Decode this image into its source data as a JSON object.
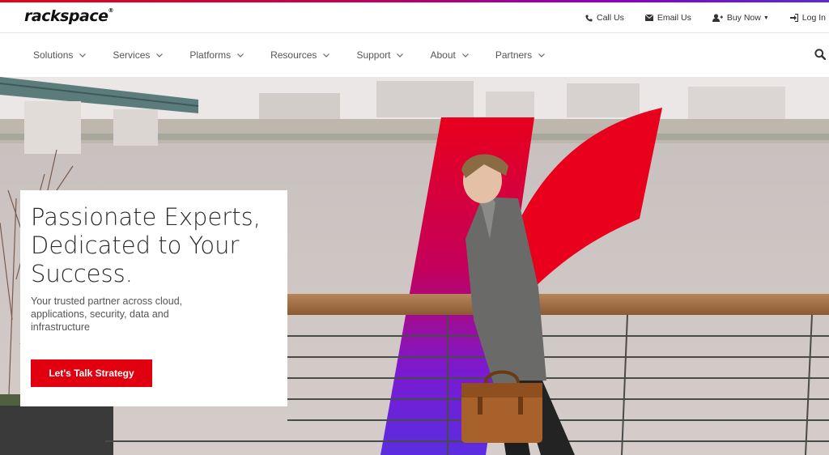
{
  "brand": {
    "logo_text": "rackspace",
    "reg_mark": "®",
    "accent_red": "#e30613",
    "accent_purple": "#5a2bd6"
  },
  "utility_nav": [
    {
      "label": "Call Us",
      "icon": "phone-icon"
    },
    {
      "label": "Email Us",
      "icon": "envelope-icon"
    },
    {
      "label": "Buy Now",
      "icon": "user-plus-icon",
      "has_dropdown": true
    },
    {
      "label": "Log In",
      "icon": "login-icon"
    }
  ],
  "main_nav": [
    {
      "label": "Solutions"
    },
    {
      "label": "Services"
    },
    {
      "label": "Platforms"
    },
    {
      "label": "Resources"
    },
    {
      "label": "Support"
    },
    {
      "label": "About"
    },
    {
      "label": "Partners"
    }
  ],
  "hero": {
    "title": "Passionate Experts, Dedicated to Your Success.",
    "subtitle": "Your trusted partner across cloud, applications, security, data and infrastructure",
    "cta_label": "Let's Talk Strategy"
  }
}
